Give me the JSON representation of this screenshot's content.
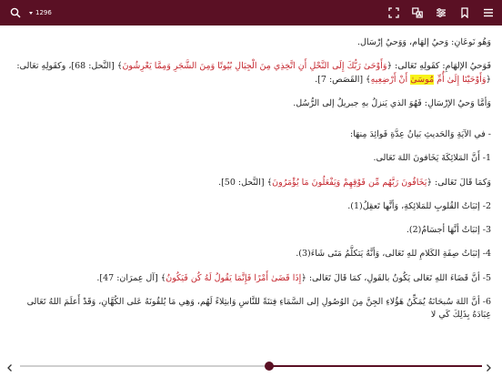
{
  "colors": {
    "bar": "#5a1024",
    "verse": "#c4242c",
    "highlight": "#f7f31a"
  },
  "toolbar": {
    "page_number": "1296",
    "icons": [
      "search-icon",
      "dropdown-caret-icon",
      "expand-icon",
      "translate-icon",
      "settings-sliders-icon",
      "bookmark-icon",
      "menu-icon"
    ]
  },
  "text": {
    "l1": "وَهُو نَوعَانِ: وَحيُ إلهَام، وَوَحيُ إرْسَال.",
    "l2_a": "فَوَحيُ الإلهَامِ: كقَولِهِ تَعَالى: ﴿",
    "l2_v": "وَأَوْحَىٰ رَبُّكَ إِلَى النَّحْلِ أَنِ اتَّخِذِي مِنَ الْجِبَالِ بُيُوتًا وَمِنَ الشَّجَرِ وَمِمَّا يَعْرِشُونَ",
    "l2_b": "﴾ [النَّحل: 68]، وكقَولِهِ تعَالى: ﴿",
    "l2_v2": "وَأَوْحَيْنَا إِلَىٰ أُمِّ",
    "l2_hl": "مُوسَىٰ",
    "l2_v3": "أَنْ أَرْضِعِيهِ",
    "l2_c": "﴾ [القَصَص: 7].",
    "l3": "وَأمَّا وَحيُ الإرْسَالِ: فَهُوَ الذي يَنزلُ بهِ جبريلُ إلى الرُّسُل.",
    "l4": "- في الآيَةِ وَالحَديثِ بَيانُ عِدَّةِ فَوائِدَ مِنهَا:",
    "l5": "1- أَنَّ المَلائِكَةَ يَخَافونَ اللهَ تَعَالى.",
    "l6_a": "وَكمَا قَالَ تَعَالى: ﴿",
    "l6_v": "يَخَافُونَ رَبَّهُم مِّن فَوْقِهِمْ وَيَفْعَلُونَ مَا يُؤْمَرُونَ",
    "l6_b": "﴾ [النَّحل: 50].",
    "l7": "2- إثبَاتُ القُلوبِ للمَلائِكةِ، وَأنَّها تَعقِلُ(1).",
    "l8": "3- إثبَاتُ أنَّهَا أجسَامٌ(2).",
    "l9": "4- إثبَاتُ صِفَةِ الكَلامِ للهِ تَعَالى، وَأنَّهُ يَتكلَّمُ مَتَى شَاءَ(3).",
    "l10_a": "5- أنَّ قَضَاءَ اللهِ تَعَالى يَكُونُ بالقَولِ، كمَا قَالَ تَعَالى: ﴿",
    "l10_v": "إِذَا قَضَىٰ أَمْرًا فَإِنَّمَا يَقُولُ لَهُ كُن فَيَكُونُ",
    "l10_b": "﴾ [آل عِمرَان: 47].",
    "l11": "6- أنَّ اللهَ سُبحَانَهُ يُمَكِّنُ هَؤُلاءِ الجِنَّ مِنَ الوُصُولِ إلى السَّمَاءِ فِتنَةً للنَّاسِ وَابتِلاءً لَهُم، وَهِي مَا يُلقُونَهُ عَلى الكُهَّانِ، وَقَدْ أَعلَمَ اللهُ تَعَالى عِبَادَهُ بِذَلِكَ كَي لا"
  },
  "nav": {
    "progress_fraction": 0.46,
    "prev_icon": "chevron-left-icon",
    "next_icon": "chevron-right-icon"
  }
}
